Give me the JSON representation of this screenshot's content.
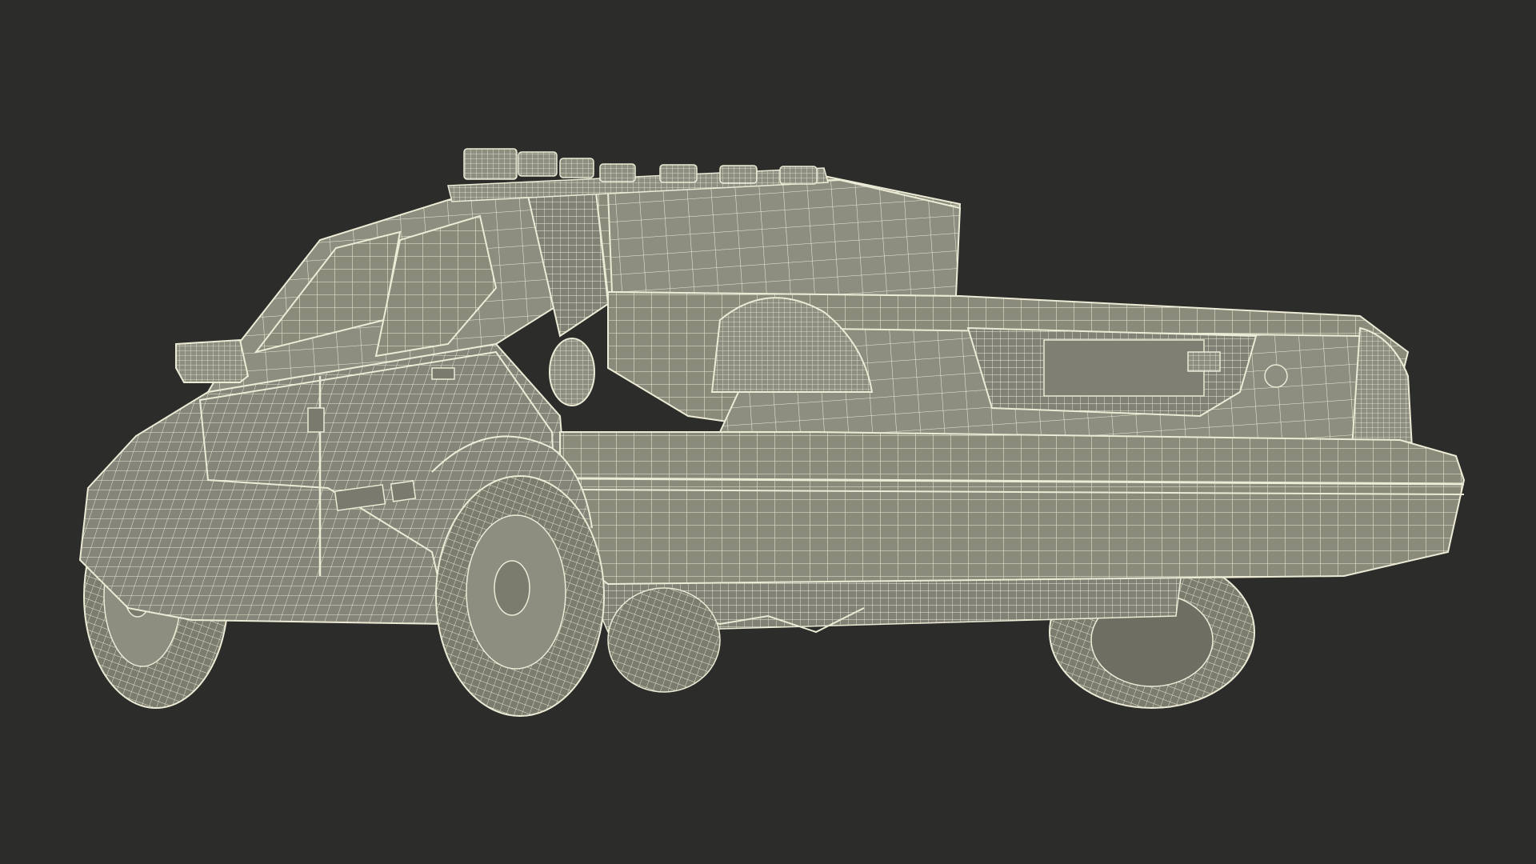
{
  "scene": {
    "subject": "police-sedan-wireframe",
    "background_color": "#2c2c2a",
    "surface_color": "#8b8b7c",
    "surface_dark_color": "#6f6f62",
    "wire_color": "#ecebd6",
    "tire_color": "#7c7c6e"
  }
}
